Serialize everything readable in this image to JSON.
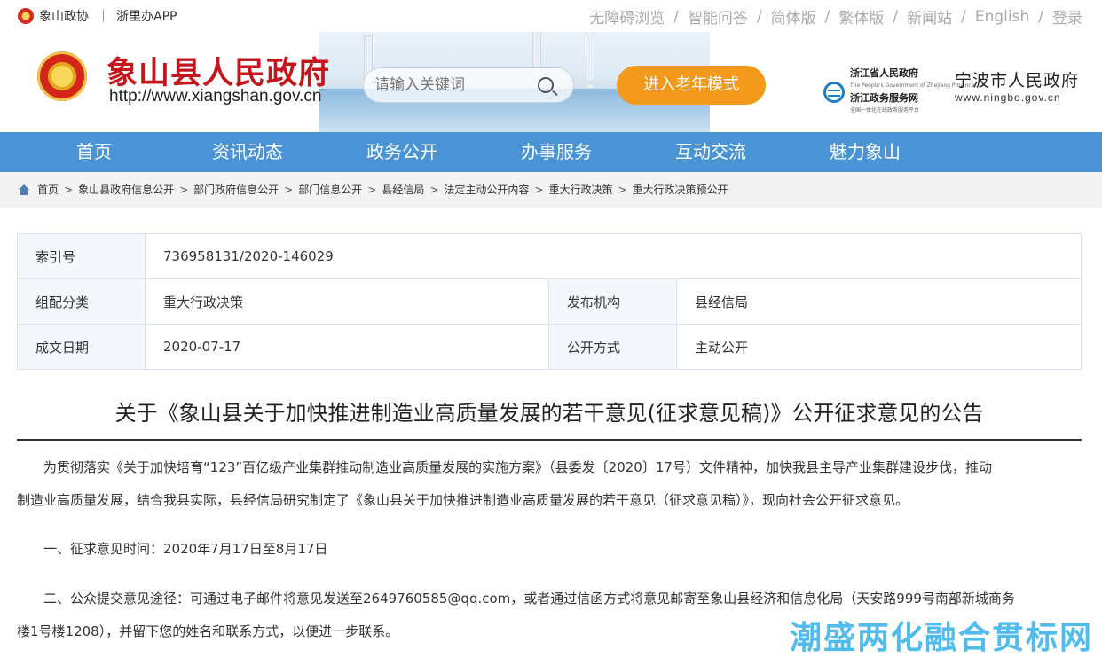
{
  "topbar": {
    "left_items": [
      "象山政协",
      "浙里办APP"
    ],
    "right_links": [
      "无障碍浏览",
      "智能问答",
      "简体版",
      "繁体版",
      "新闻站",
      "English",
      "登录"
    ],
    "separator": "/"
  },
  "header": {
    "title": "象山县人民政府",
    "url": "http://www.xiangshan.gov.cn",
    "search_placeholder": "请输入关键词",
    "elder_mode_label": "进入老年模式",
    "zj_line1": "浙江省人民政府",
    "zj_line2": "浙江政务服务网",
    "zj_small_top": "The People's Government of Zhejiang Province",
    "zj_small_bottom": "全国一体化在线政务服务平台",
    "nb_title": "宁波市人民政府",
    "nb_url": "www.ningbo.gov.cn"
  },
  "nav": {
    "items": [
      "首页",
      "资讯动态",
      "政务公开",
      "办事服务",
      "互动交流",
      "魅力象山"
    ]
  },
  "breadcrumb": [
    "首页",
    "象山县政府信息公开",
    "部门政府信息公开",
    "部门信息公开",
    "县经信局",
    "法定主动公开内容",
    "重大行政决策",
    "重大行政决策预公开"
  ],
  "meta": {
    "index_label": "索引号",
    "index_value": "736958131/2020-146029",
    "category_label": "组配分类",
    "category_value": "重大行政决策",
    "publisher_label": "发布机构",
    "publisher_value": "县经信局",
    "date_label": "成文日期",
    "date_value": "2020-07-17",
    "mode_label": "公开方式",
    "mode_value": "主动公开"
  },
  "article": {
    "title": "关于《象山县关于加快推进制造业高质量发展的若干意见(征求意见稿)》公开征求意见的公告",
    "p1_line1": "为贯彻落实《关于加快培育“123”百亿级产业集群推动制造业高质量发展的实施方案》（县委发〔2020〕17号）文件精神，加快我县主导产业集群建设步伐，推动",
    "p1_line2": "制造业高质量发展，结合我县实际，县经信局研究制定了《象山县关于加快推进制造业高质量发展的若干意见（征求意见稿）》，现向社会公开征求意见。",
    "p2": "一、征求意见时间：2020年7月17日至8月17日",
    "p3_line1": "二、公众提交意见途径：可通过电子邮件将意见发送至2649760585@qq.com，或者通过信函方式将意见邮寄至象山县经济和信息化局（天安路999号南部新城商务",
    "p3_line2": "楼1号楼1208），并留下您的姓名和联系方式，以便进一步联系。"
  },
  "watermark": "潮盛两化融合贯标网"
}
